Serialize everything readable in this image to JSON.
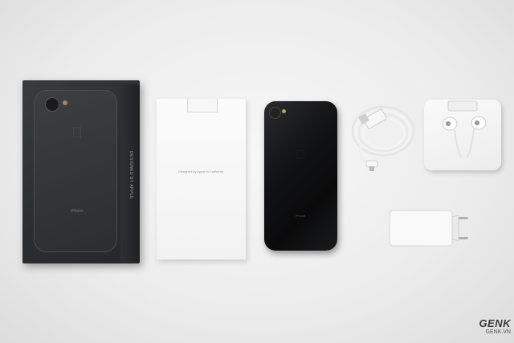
{
  "box": {
    "side_text": "DESIGNED BY APPLE",
    "front_text": "iPhone"
  },
  "manual": {
    "text": "Designed by Apple in California"
  },
  "phone": {
    "text": "iPhone"
  },
  "watermark": {
    "logo": "GENK",
    "url": "GENK.VN"
  },
  "icons": [
    "apple-logo-icon",
    "lightning-cable",
    "earpods",
    "usb-power-adapter"
  ],
  "colors": {
    "background": "#ececec",
    "jet_black": "#111214",
    "white_accessory": "#f5f5f5"
  }
}
